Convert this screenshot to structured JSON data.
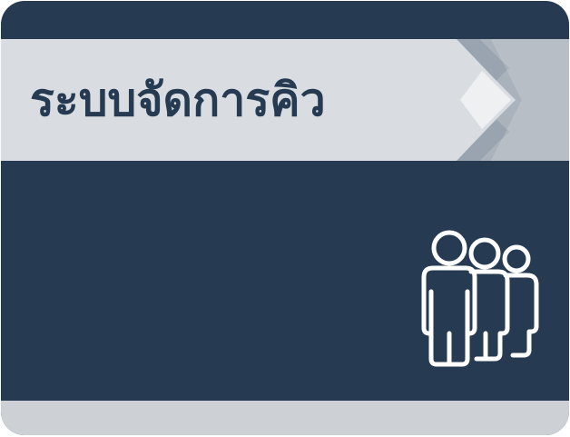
{
  "title": "ระบบจัดการคิว",
  "icon": "people-group-icon",
  "colors": {
    "background": "#263a52",
    "banner": "#d9dde2",
    "banner_right": "#b7bec6",
    "chevron_dark": "#8a95a2",
    "diamond": "#eef0f2",
    "bottom_strip": "#cdd1d6",
    "icon_stroke": "#ffffff"
  }
}
